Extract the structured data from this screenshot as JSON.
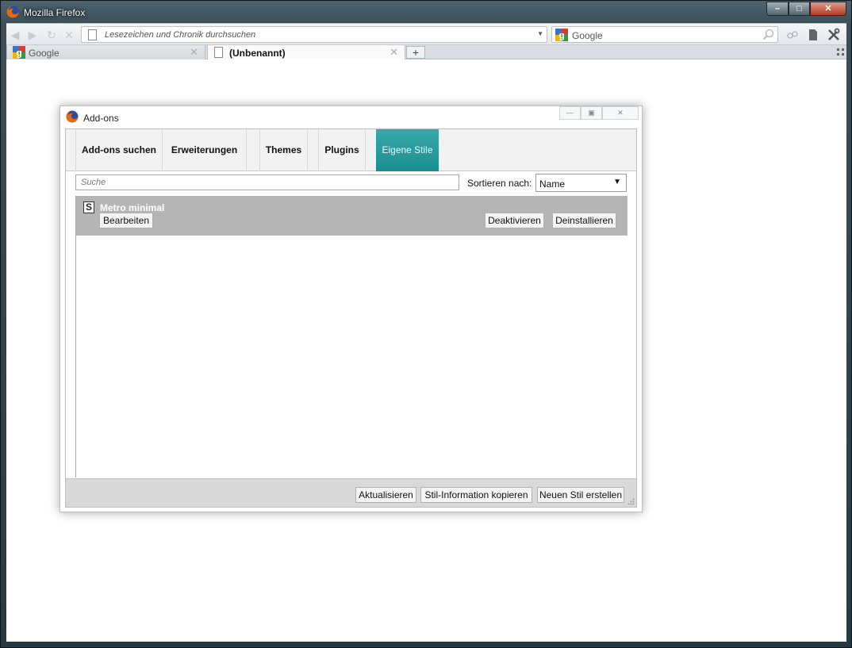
{
  "window": {
    "title": "Mozilla Firefox"
  },
  "toolbar": {
    "url_placeholder": "Lesezeichen und Chronik durchsuchen",
    "search_engine": "Google"
  },
  "tabs": [
    {
      "label": "Google"
    },
    {
      "label": "(Unbenannt)"
    }
  ],
  "addons": {
    "title": "Add-ons",
    "categories": [
      "Add-ons suchen",
      "Erweiterungen",
      "Themes",
      "Plugins",
      "Eigene Stile"
    ],
    "selected_category": "Eigene Stile",
    "search_placeholder": "Suche",
    "sort_label": "Sortieren nach:",
    "sort_value": "Name",
    "styles": [
      {
        "name": "Metro minimal",
        "edit_label": "Bearbeiten",
        "disable_label": "Deaktivieren",
        "uninstall_label": "Deinstallieren"
      }
    ],
    "footer": {
      "update_label": "Aktualisieren",
      "copy_label": "Stil-Information kopieren",
      "new_label": "Neuen Stil erstellen"
    }
  },
  "colors": {
    "accent": "#23999b",
    "row_bg": "#b5b5b5",
    "close_button": "#c2462b"
  }
}
